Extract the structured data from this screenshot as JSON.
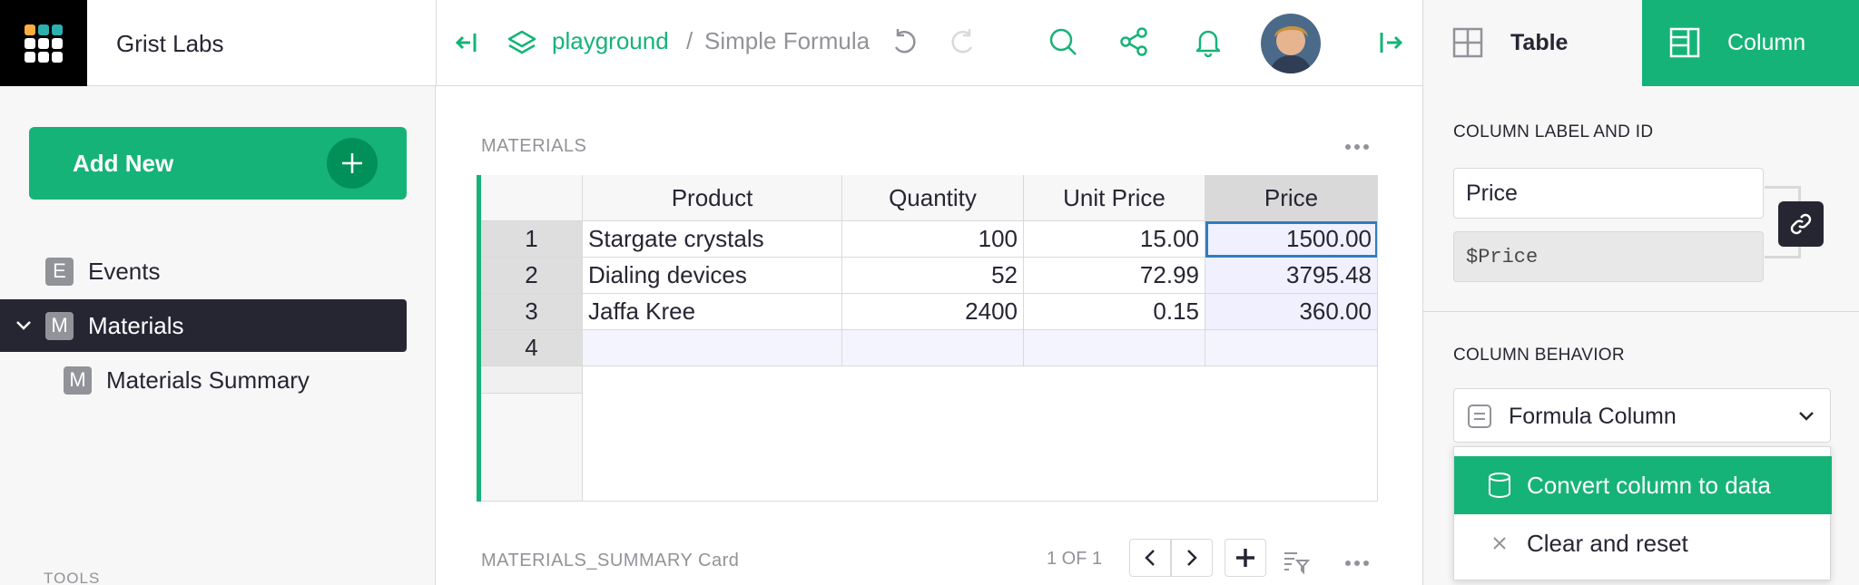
{
  "header": {
    "org_name": "Grist Labs",
    "breadcrumb": {
      "workspace": "playground",
      "separator": "/",
      "document": "Simple Formula"
    },
    "right_tabs": {
      "table": "Table",
      "column": "Column"
    }
  },
  "left_panel": {
    "add_new": "Add New",
    "pages": [
      {
        "icon_letter": "E",
        "label": "Events"
      },
      {
        "icon_letter": "M",
        "label": "Materials",
        "selected": true
      },
      {
        "icon_letter": "M",
        "label": "Materials Summary"
      }
    ],
    "tools_label": "TOOLS"
  },
  "main": {
    "section1_title": "MATERIALS",
    "columns": [
      "Product",
      "Quantity",
      "Unit Price",
      "Price"
    ],
    "rows": [
      {
        "num": "1",
        "product": "Stargate crystals",
        "quantity": "100",
        "unit_price": "15.00",
        "price": "1500.00"
      },
      {
        "num": "2",
        "product": "Dialing devices",
        "quantity": "52",
        "unit_price": "72.99",
        "price": "3795.48"
      },
      {
        "num": "3",
        "product": "Jaffa Kree",
        "quantity": "2400",
        "unit_price": "0.15",
        "price": "360.00"
      }
    ],
    "add_row_num": "4",
    "section2_title": "MATERIALS_SUMMARY Card",
    "pager": "1 OF 1"
  },
  "right_panel": {
    "label_section": "COLUMN LABEL AND ID",
    "column_label": "Price",
    "column_id": "$Price",
    "behavior_section": "COLUMN BEHAVIOR",
    "behavior_value": "Formula Column",
    "menu": {
      "convert": "Convert column to data",
      "clear": "Clear and reset"
    }
  },
  "colors": {
    "accent": "#16b378",
    "dark": "#262633",
    "muted": "#929299",
    "cursor": "#2f7dc1"
  }
}
